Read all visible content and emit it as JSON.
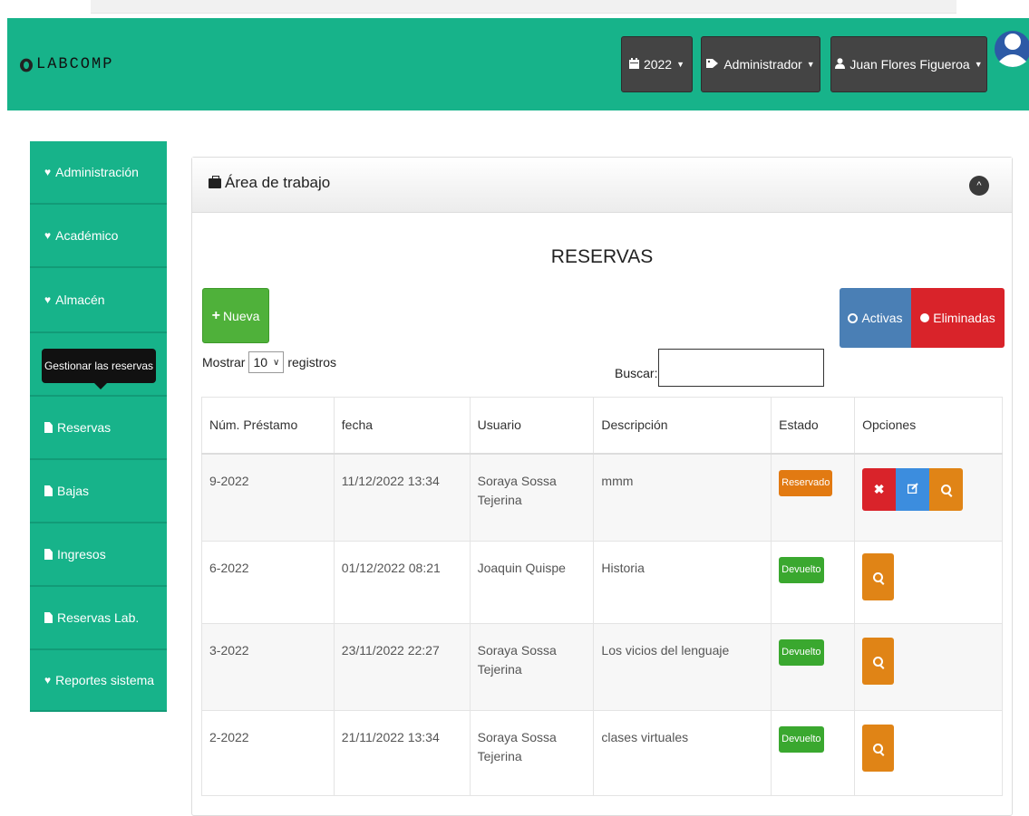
{
  "navbar": {
    "brand": "LABCOMP",
    "year_label": "2022",
    "role_label": "Administrador",
    "user_label": "Juan Flores Figueroa"
  },
  "sidebar": {
    "items": [
      {
        "label": "Administración",
        "icon": "heart-icon"
      },
      {
        "label": "Académico",
        "icon": "heart-icon"
      },
      {
        "label": "Almacén",
        "icon": "heart-icon"
      },
      {
        "label": "",
        "icon": "none"
      },
      {
        "label": "Reservas",
        "icon": "document-icon"
      },
      {
        "label": "Bajas",
        "icon": "document-icon"
      },
      {
        "label": "Ingresos",
        "icon": "document-icon"
      },
      {
        "label": "Reservas Lab.",
        "icon": "document-icon"
      },
      {
        "label": "Reportes sistema",
        "icon": "heart-icon"
      }
    ],
    "tooltip": "Gestionar las reservas"
  },
  "panel": {
    "title": "Área de trabajo",
    "section_title": "RESERVAS",
    "new_button": "Nueva",
    "filter_active": "Activas",
    "filter_deleted": "Eliminadas",
    "length_prefix": "Mostrar",
    "length_value": "10",
    "length_suffix": "registros",
    "search_label": "Buscar:",
    "search_value": ""
  },
  "table": {
    "headers": [
      "Núm. Préstamo",
      "fecha",
      "Usuario",
      "Descripción",
      "Estado",
      "Opciones"
    ],
    "rows": [
      {
        "num": "9-2022",
        "fecha": "11/12/2022 13:34",
        "usuario_1": "Soraya Sossa",
        "usuario_2": "Tejerina",
        "descripcion": "mmm",
        "estado": "Reservado"
      },
      {
        "num": "6-2022",
        "fecha": "01/12/2022 08:21",
        "usuario_1": "Joaquin Quispe",
        "usuario_2": "",
        "descripcion": "Historia",
        "estado": "Devuelto"
      },
      {
        "num": "3-2022",
        "fecha": "23/11/2022 22:27",
        "usuario_1": "Soraya Sossa",
        "usuario_2": "Tejerina",
        "descripcion": "Los vicios del lenguaje",
        "estado": "Devuelto"
      },
      {
        "num": "2-2022",
        "fecha": "21/11/2022 13:34",
        "usuario_1": "Soraya Sossa",
        "usuario_2": "Tejerina",
        "descripcion": "clases virtuales",
        "estado": "Devuelto"
      }
    ]
  },
  "colors": {
    "brand_green": "#17b38a",
    "navbar_button": "#444444",
    "new_button": "#4fb13a",
    "active_filter": "#4a7fb5",
    "deleted_filter": "#d9232a",
    "status_reserved": "#e27a12",
    "status_returned": "#3aa82f",
    "edit_button": "#3c8dde",
    "view_button": "#e08416"
  }
}
